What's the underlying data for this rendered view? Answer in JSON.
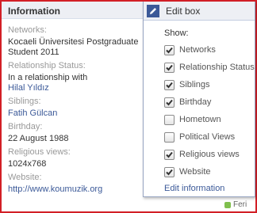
{
  "info": {
    "title": "Information",
    "fields": [
      {
        "label": "Networks:",
        "value": "Kocaeli Üniversitesi Postgraduate Student 2011"
      },
      {
        "label": "Relationship Status:",
        "value": "In a relationship with",
        "link": "Hilal Yıldız"
      },
      {
        "label": "Siblings:",
        "link": "Fatih Gülcan"
      },
      {
        "label": "Birthday:",
        "value": "22 August 1988"
      },
      {
        "label": "Religious views:",
        "value": "1024x768"
      },
      {
        "label": "Website:",
        "link": "http://www.koumuzik.org"
      }
    ]
  },
  "edit_box": {
    "title": "Edit box",
    "show_label": "Show:",
    "options": [
      {
        "label": "Networks",
        "checked": true
      },
      {
        "label": "Relationship Status",
        "checked": true
      },
      {
        "label": "Siblings",
        "checked": true
      },
      {
        "label": "Birthday",
        "checked": true
      },
      {
        "label": "Hometown",
        "checked": false
      },
      {
        "label": "Political Views",
        "checked": false
      },
      {
        "label": "Religious views",
        "checked": true
      },
      {
        "label": "Website",
        "checked": true
      }
    ],
    "edit_link": "Edit information"
  },
  "chat": {
    "label": "Feri"
  },
  "colors": {
    "link": "#3b5998",
    "frame": "#d21f26",
    "header_bg": "#edeff4"
  }
}
